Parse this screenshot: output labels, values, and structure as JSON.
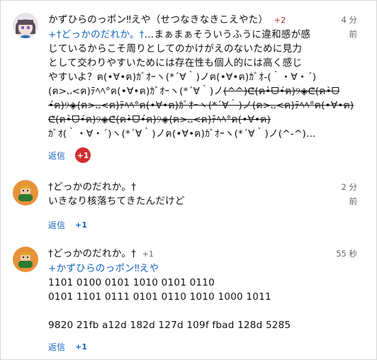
{
  "comments": [
    {
      "author": "かずひらのっポン‼えや（せつなきなきこえやた）",
      "badge": "+2",
      "time_lines": [
        "4 分",
        "前"
      ],
      "lines": [
        {
          "parts": [
            {
              "t": "+",
              "c": "link"
            },
            {
              "t": "†どっかのだれか。†",
              "c": "link"
            },
            {
              "t": "…まぁまぁそういうふうに違和感が感",
              "c": ""
            }
          ]
        },
        {
          "parts": [
            {
              "t": "じているからこそ周りとしてのかけがえのないために見力",
              "c": ""
            }
          ]
        },
        {
          "parts": [
            {
              "t": "として交わりやすいためには存在性も個人的には高く感じ",
              "c": ""
            }
          ]
        },
        {
          "parts": [
            {
              "t": "やすいよ？ฅ(•∀•ฅ)ｶﾞｵｰヽ(*´∀｀)ノฅ(•∀•ฅ)ｶﾞｵ-(｀・∀・´)",
              "c": ""
            }
          ]
        },
        {
          "parts": [
            {
              "t": "(ฅ>᎑<ฅ)ﾃﾍﾍ°ฅ(•∀•ฅ)ｶﾞｵｰヽ(*´∀｀)ノ",
              "c": ""
            },
            {
              "t": "(^^)ᕦ(ฅ•̀ᗜ•́ฅ)୨◈ᕦ(ฅ•̀ᗜ",
              "c": "strike"
            }
          ]
        },
        {
          "parts": [
            {
              "t": "•́ฅ)୨◈(ฅ>᎑<ฅ)ﾃﾍﾍ°ฅ(•∀•ฅ)ｶﾞｵｰヽ(*´∀｀)ノ(ฅ>᎑<ฅ)ﾃﾍﾍ°ฅ(•∀•ฅ)",
              "c": "strike"
            }
          ]
        },
        {
          "parts": [
            {
              "t": "ᕦ(ฅ•̀ᗜ•́ฅ)୨◈ᕦ(ฅ•̀ᗜ•́ฅ)୨◈(ฅ>᎑<ฅ)ﾃﾍﾍ°ฅ(•∀•ฅ)",
              "c": "strike"
            }
          ]
        },
        {
          "parts": [
            {
              "t": "ｶﾞｵ(｀・∀・´)ヽ(*´∀｀)ノฅ(•∀•ฅ)ｶﾞｵｰヽ(*´∀｀)ノ(^-^)…",
              "c": ""
            }
          ]
        }
      ],
      "reply": "返信",
      "plus": "+1",
      "plus_style": "red"
    },
    {
      "author": "†どっかのだれか。†",
      "badge": "",
      "time_lines": [
        "2 分",
        "前"
      ],
      "lines": [
        {
          "parts": [
            {
              "t": "いきなり核落ちてきたんだけど",
              "c": ""
            }
          ]
        }
      ],
      "reply": "返信",
      "plus": "+1",
      "plus_style": "plain"
    },
    {
      "author": "†どっかのだれか。†",
      "badge": "+1",
      "time_lines": [
        "55 秒"
      ],
      "lines": [
        {
          "parts": [
            {
              "t": "+かずひらのっポン‼えや",
              "c": "link"
            }
          ]
        },
        {
          "parts": [
            {
              "t": "1101 0100 0101 1010 0101 0110",
              "c": ""
            }
          ]
        },
        {
          "parts": [
            {
              "t": "0101 1101 0111 0101 0110 1010 1000 1011",
              "c": ""
            }
          ]
        },
        {
          "parts": [
            {
              "t": "",
              "c": ""
            }
          ]
        },
        {
          "parts": [
            {
              "t": "9820 21fb a12d 182d 127d 109f fbad 128d 5285",
              "c": ""
            }
          ]
        }
      ],
      "reply": "返信",
      "plus": "+1",
      "plus_style": "plain"
    }
  ]
}
